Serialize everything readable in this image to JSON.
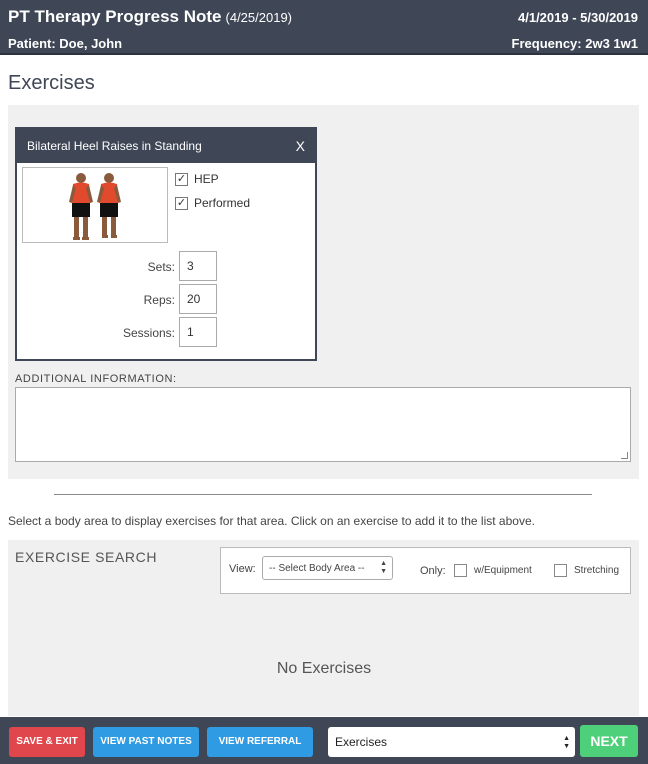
{
  "header": {
    "title": "PT Therapy Progress Note",
    "note_date": "(4/25/2019)",
    "date_range": "4/1/2019 - 5/30/2019",
    "patient": "Patient: Doe, John",
    "frequency": "Frequency: 2w3 1w1"
  },
  "section_title": "Exercises",
  "exercise_card": {
    "name": "Bilateral Heel Raises in Standing",
    "close_label": "X",
    "hep_label": "HEP",
    "hep_checked": true,
    "performed_label": "Performed",
    "performed_checked": true,
    "sets_label": "Sets:",
    "sets_value": "3",
    "reps_label": "Reps:",
    "reps_value": "20",
    "sessions_label": "Sessions:",
    "sessions_value": "1"
  },
  "additional_info": {
    "label": "ADDITIONAL INFORMATION:",
    "value": ""
  },
  "instructions": "Select a body area to display exercises for that area. Click on an exercise to add it to the list above.",
  "exercise_search": {
    "title": "EXERCISE SEARCH",
    "view_label": "View:",
    "body_area_selected": "-- Select Body Area --",
    "only_label": "Only:",
    "equipment_label": "w/Equipment",
    "stretching_label": "Stretching",
    "empty_text": "No Exercises"
  },
  "footer": {
    "save_exit": "SAVE & EXIT",
    "view_past_notes": "VIEW PAST NOTES",
    "view_referral": "VIEW REFERRAL",
    "section_selected": "Exercises",
    "next": "NEXT"
  },
  "colors": {
    "header_bg": "#3f4757",
    "save_exit": "#e0474c",
    "blue_button": "#2e9be3",
    "next_button": "#4ed07a",
    "panel_bg": "#f0f0f1"
  }
}
